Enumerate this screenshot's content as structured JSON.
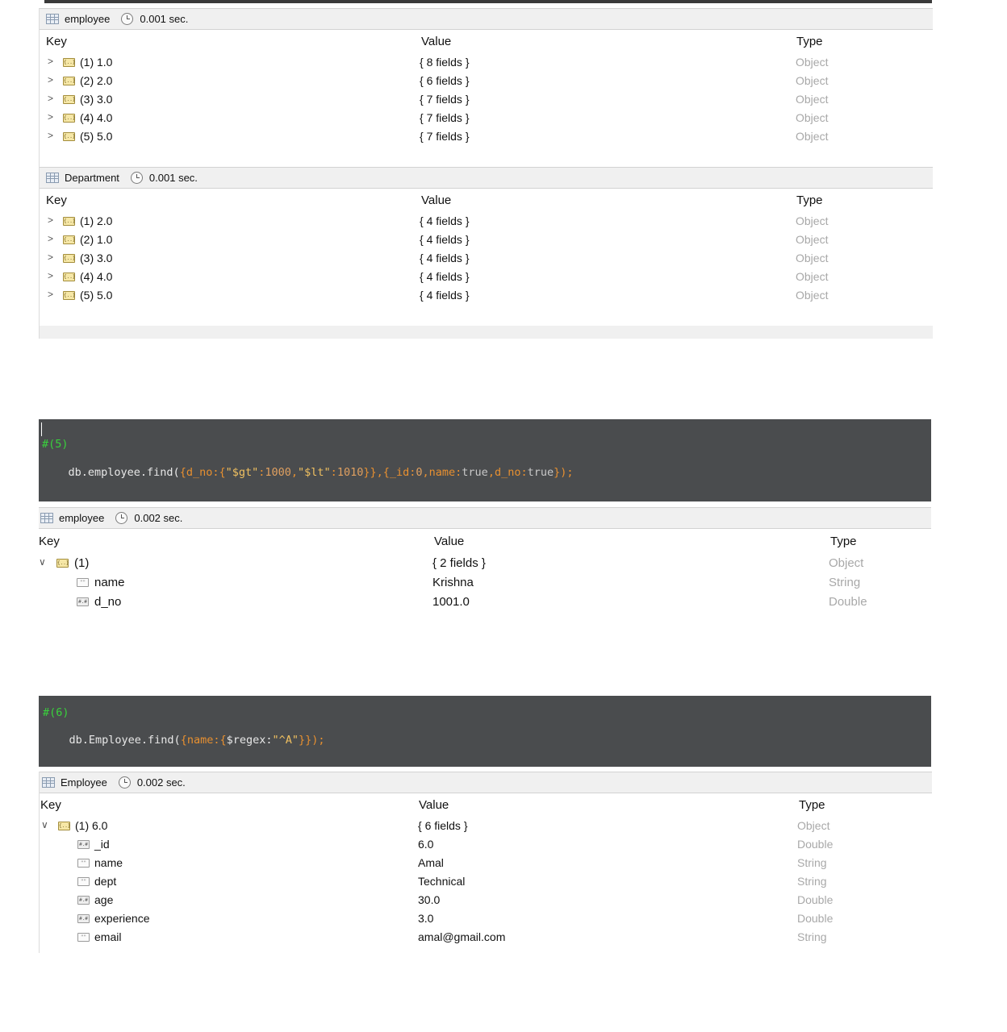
{
  "panel1": {
    "collection": "employee",
    "time": "0.001 sec.",
    "headers": {
      "key": "Key",
      "value": "Value",
      "type": "Type"
    },
    "rows": [
      {
        "key": "(1) 1.0",
        "value": "{ 8 fields }",
        "type": "Object"
      },
      {
        "key": "(2) 2.0",
        "value": "{ 6 fields }",
        "type": "Object"
      },
      {
        "key": "(3) 3.0",
        "value": "{ 7 fields }",
        "type": "Object"
      },
      {
        "key": "(4) 4.0",
        "value": "{ 7 fields }",
        "type": "Object"
      },
      {
        "key": "(5) 5.0",
        "value": "{ 7 fields }",
        "type": "Object"
      }
    ]
  },
  "panel2": {
    "collection": "Department",
    "time": "0.001 sec.",
    "headers": {
      "key": "Key",
      "value": "Value",
      "type": "Type"
    },
    "rows": [
      {
        "key": "(1) 2.0",
        "value": "{ 4 fields }",
        "type": "Object"
      },
      {
        "key": "(2) 1.0",
        "value": "{ 4 fields }",
        "type": "Object"
      },
      {
        "key": "(3) 3.0",
        "value": "{ 4 fields }",
        "type": "Object"
      },
      {
        "key": "(4) 4.0",
        "value": "{ 4 fields }",
        "type": "Object"
      },
      {
        "key": "(5) 5.0",
        "value": "{ 4 fields }",
        "type": "Object"
      }
    ]
  },
  "query5": {
    "comment": "#(5)",
    "code_parts": [
      "db.employee.find(",
      "{d_no:{",
      "\"$gt\"",
      ":",
      "1000",
      ",",
      "\"$lt\"",
      ":",
      "1010",
      "}}",
      ",{_id:",
      "0",
      ",name:",
      "true",
      ",d_no:",
      "true",
      "});"
    ]
  },
  "panel3": {
    "collection": "employee",
    "time": "0.002 sec.",
    "headers": {
      "key": "Key",
      "value": "Value",
      "type": "Type"
    },
    "root": {
      "key": "(1)",
      "value": "{ 2 fields }",
      "type": "Object"
    },
    "fields": [
      {
        "key": "name",
        "value": "Krishna",
        "type": "String",
        "icon": "string"
      },
      {
        "key": "d_no",
        "value": "1001.0",
        "type": "Double",
        "icon": "number"
      }
    ]
  },
  "query6": {
    "comment": "#(6)",
    "code_parts": [
      "db.Employee.find(",
      "{name:{",
      "$regex:",
      "\"^A\"",
      "}});"
    ]
  },
  "panel4": {
    "collection": "Employee",
    "time": "0.002 sec.",
    "headers": {
      "key": "Key",
      "value": "Value",
      "type": "Type"
    },
    "root": {
      "key": "(1) 6.0",
      "value": "{ 6 fields }",
      "type": "Object"
    },
    "fields": [
      {
        "key": "_id",
        "value": "6.0",
        "type": "Double",
        "icon": "number"
      },
      {
        "key": "name",
        "value": "Amal",
        "type": "String",
        "icon": "string"
      },
      {
        "key": "dept",
        "value": "Technical",
        "type": "String",
        "icon": "string"
      },
      {
        "key": "age",
        "value": "30.0",
        "type": "Double",
        "icon": "number"
      },
      {
        "key": "experience",
        "value": "3.0",
        "type": "Double",
        "icon": "number"
      },
      {
        "key": "email",
        "value": "amal@gmail.com",
        "type": "String",
        "icon": "string"
      }
    ]
  },
  "icons": {
    "document": "document-icon",
    "string": "string-field-icon",
    "number": "number-field-icon",
    "table": "table-icon",
    "clock": "clock-icon"
  }
}
